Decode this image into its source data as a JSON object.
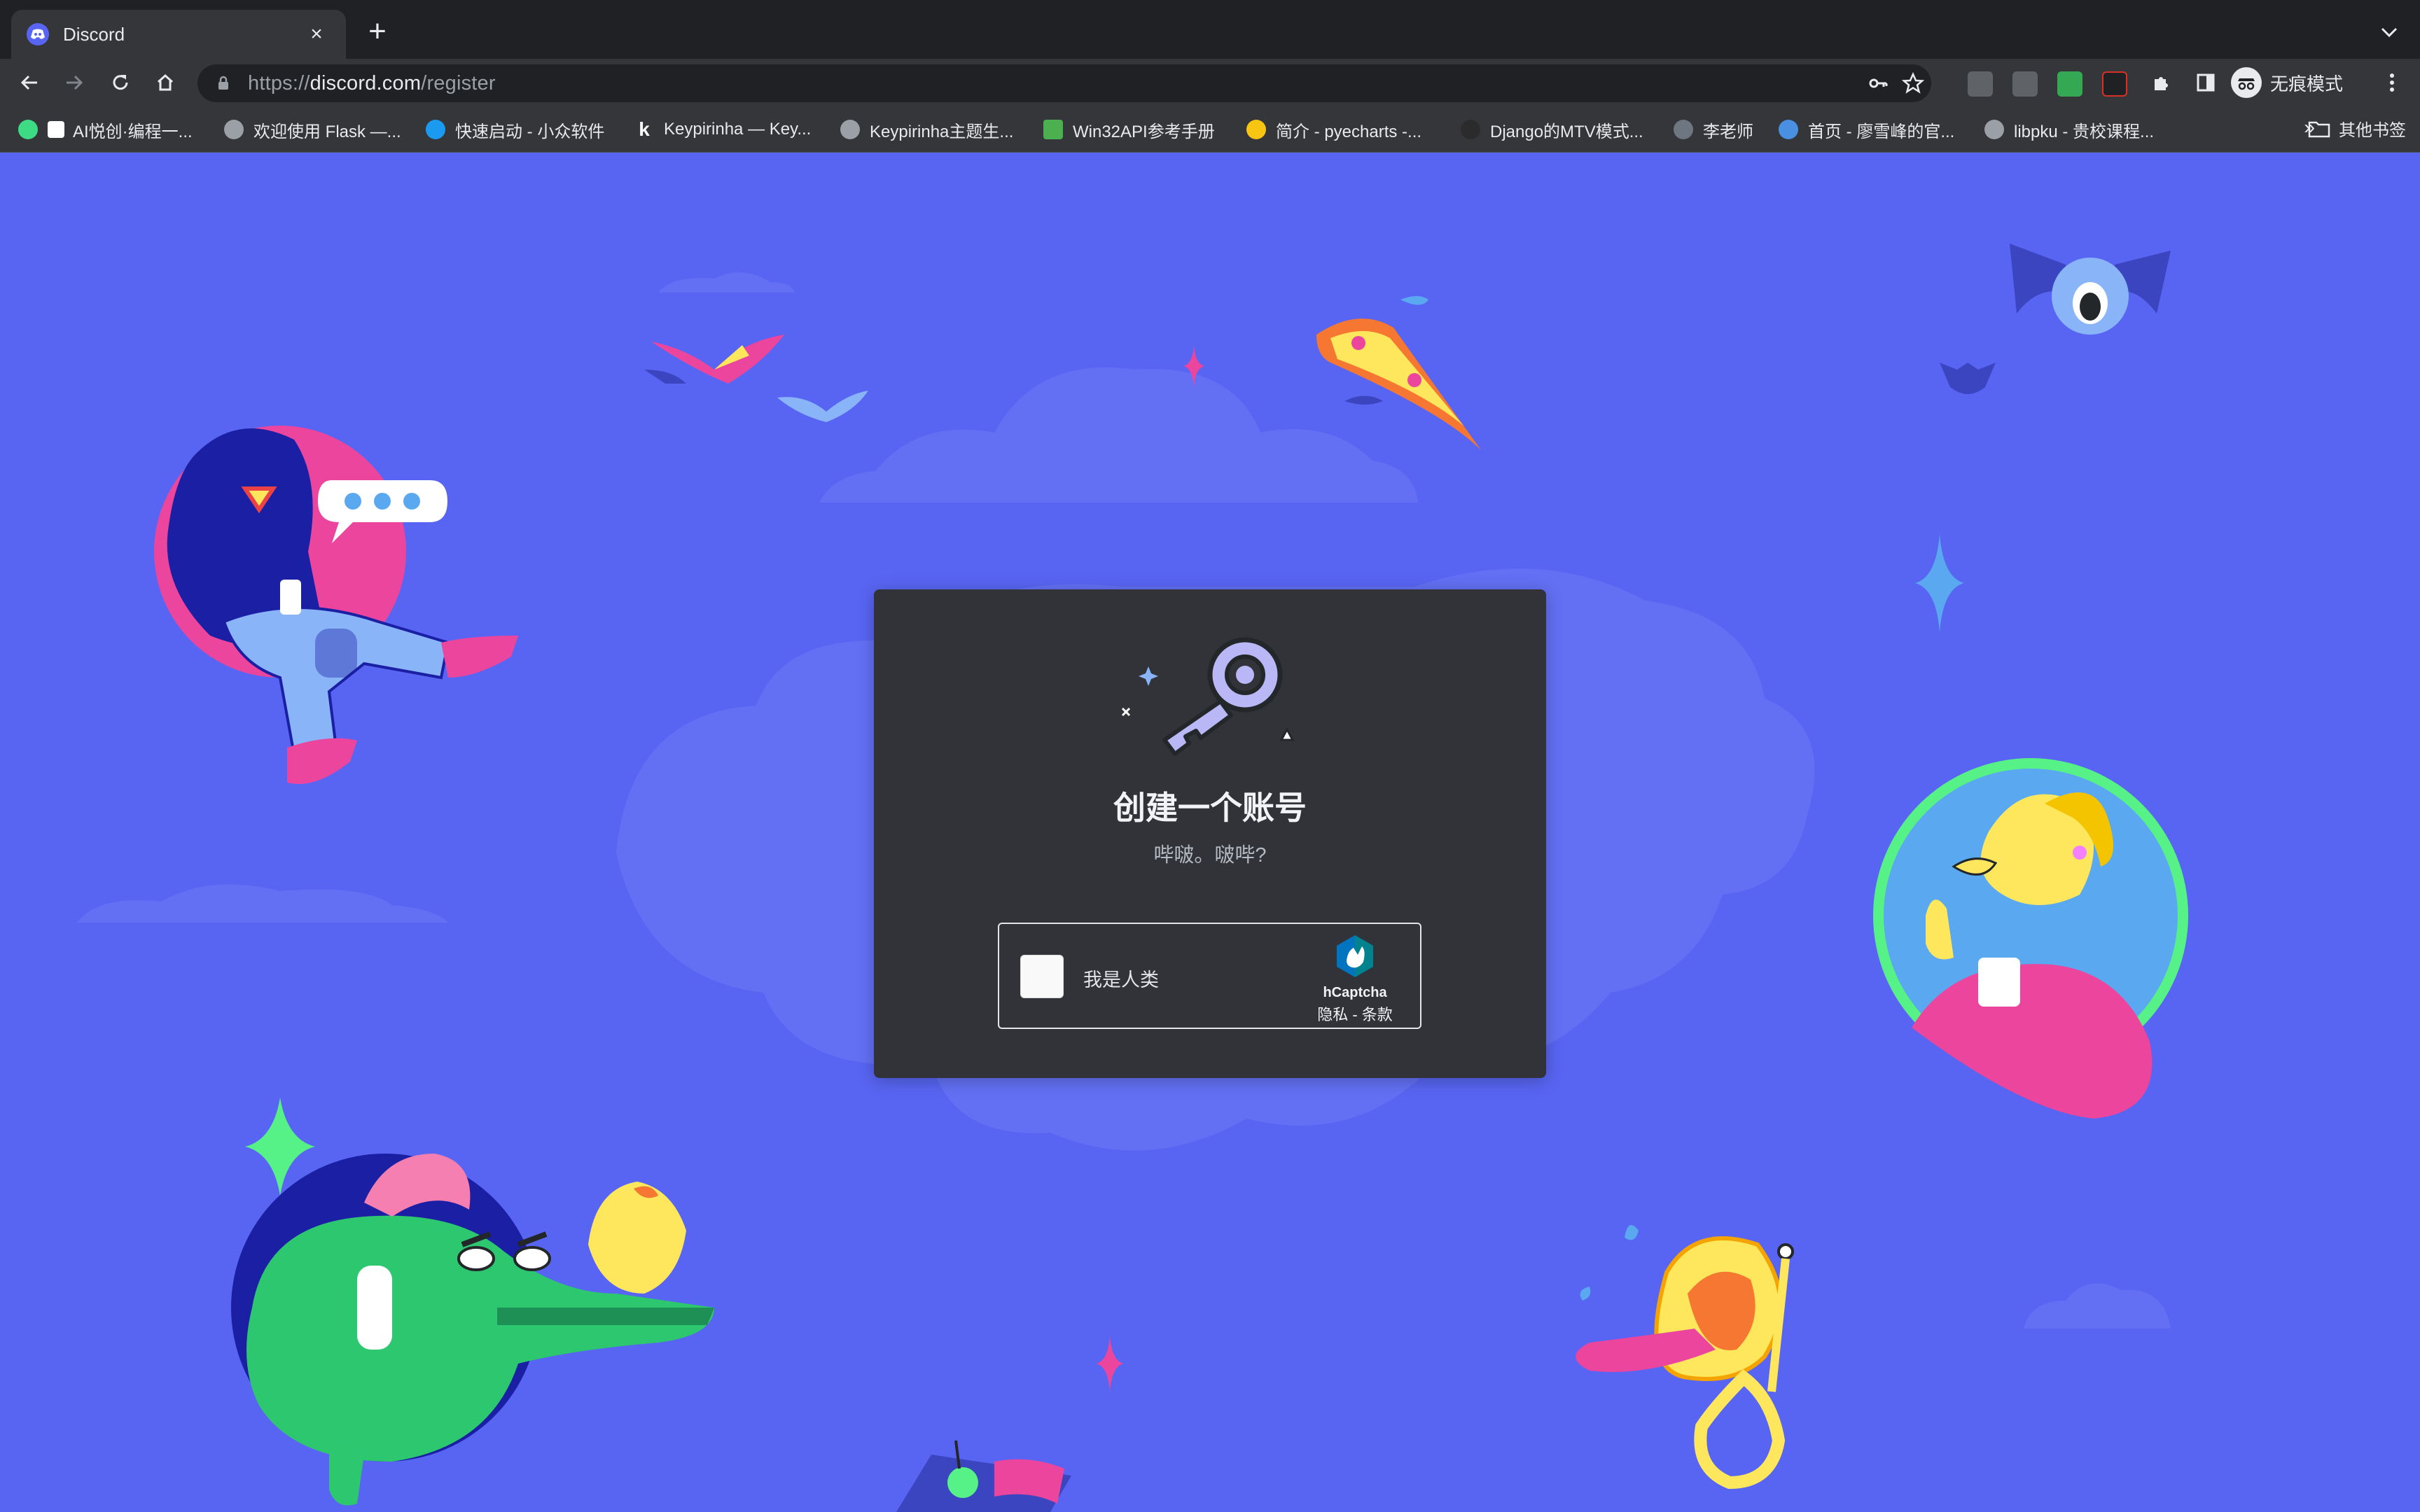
{
  "browser": {
    "tab": {
      "title": "Discord",
      "close": "×"
    },
    "new_tab": "+",
    "url": {
      "scheme": "https://",
      "host": "discord.com",
      "path": "/register"
    },
    "incognito_label": "无痕模式"
  },
  "bookmarks": [
    {
      "label": "AI悦创·编程一...",
      "color": "#3ddc84"
    },
    {
      "label": "欢迎使用 Flask —...",
      "color": "#9aa0a6"
    },
    {
      "label": "快速启动 - 小众软件",
      "color": "#1a9bf0"
    },
    {
      "label": "Keypirinha — Key...",
      "color": "#ffffff"
    },
    {
      "label": "Keypirinha主题生...",
      "color": "#9aa0a6"
    },
    {
      "label": "Win32API参考手册",
      "color": "#4caf50"
    },
    {
      "label": "简介 - pyecharts -...",
      "color": "#f9c513"
    },
    {
      "label": "Django的MTV模式...",
      "color": "#2b2b2b"
    },
    {
      "label": "李老师",
      "color": "#6e7681"
    },
    {
      "label": "首页 - 廖雪峰的官...",
      "color": "#4a90e2"
    },
    {
      "label": "libpku - 贵校课程...",
      "color": "#9aa0a6"
    }
  ],
  "bookmarks_overflow": "»",
  "bookmarks_other": "其他书签",
  "register": {
    "title": "创建一个账号",
    "subtitle": "哔啵。啵哔?",
    "captcha": {
      "checkbox_label": "我是人类",
      "brand": "hCaptcha",
      "links": "隐私 - 条款"
    }
  },
  "colors": {
    "background": "#5865f2",
    "card": "#313338",
    "clouds": "#6370f4"
  }
}
